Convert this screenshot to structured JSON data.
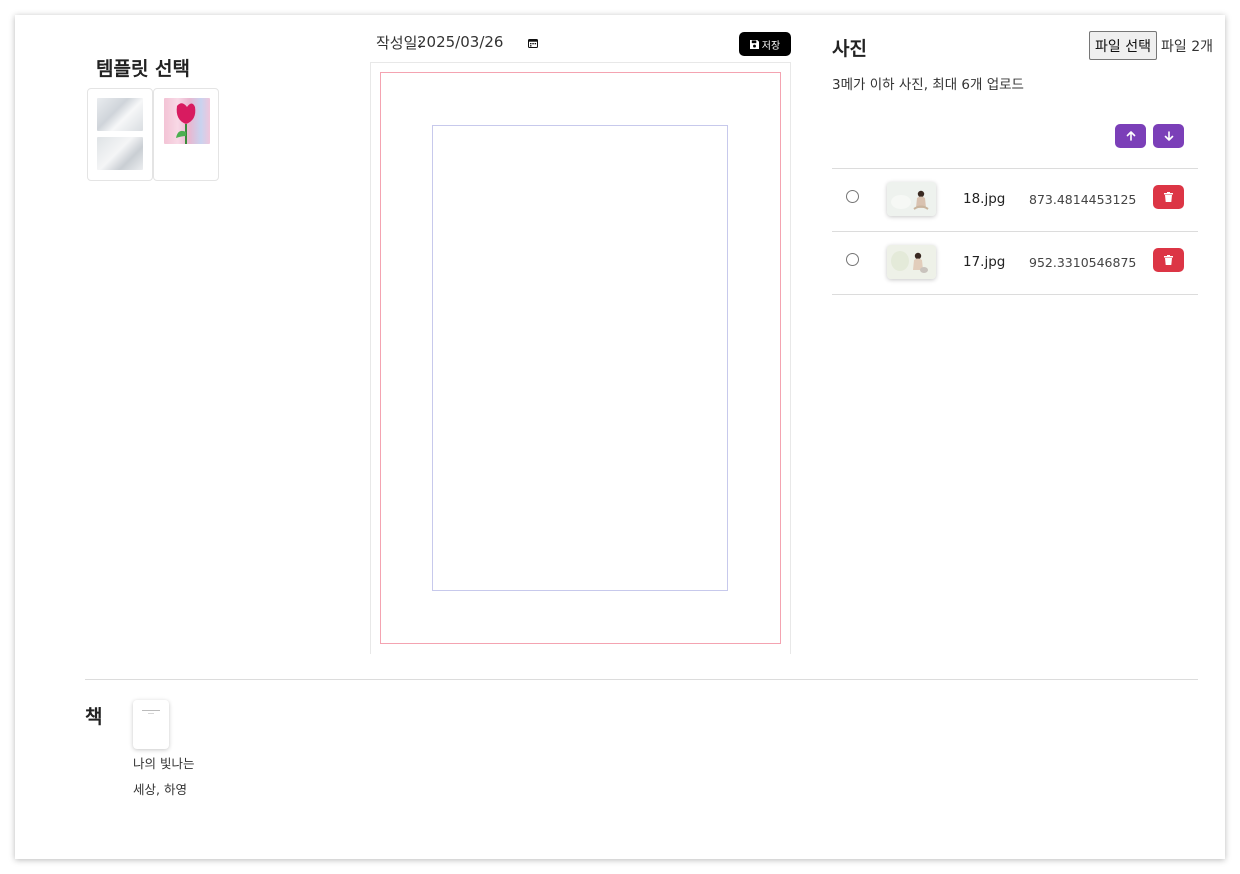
{
  "template": {
    "title": "템플릿 선택"
  },
  "editor": {
    "date_label": "작성일:",
    "date_value": "2025/03/26",
    "save_label": "저장"
  },
  "photos": {
    "title": "사진",
    "file_button": "파일 선택",
    "file_count": "파일 2개",
    "hint": "3메가 이하 사진, 최대 6개 업로드",
    "items": [
      {
        "name": "18.jpg",
        "size": "873.4814453125"
      },
      {
        "name": "17.jpg",
        "size": "952.3310546875"
      }
    ]
  },
  "book": {
    "title": "책",
    "name_line1": "나의 빛나는",
    "name_line2": "세상, 하영"
  },
  "colors": {
    "accent_purple": "#7b3fb8",
    "danger_red": "#dc3545",
    "page_outer_border": "#f4a3b1",
    "page_inner_border": "#c7c9ec"
  }
}
